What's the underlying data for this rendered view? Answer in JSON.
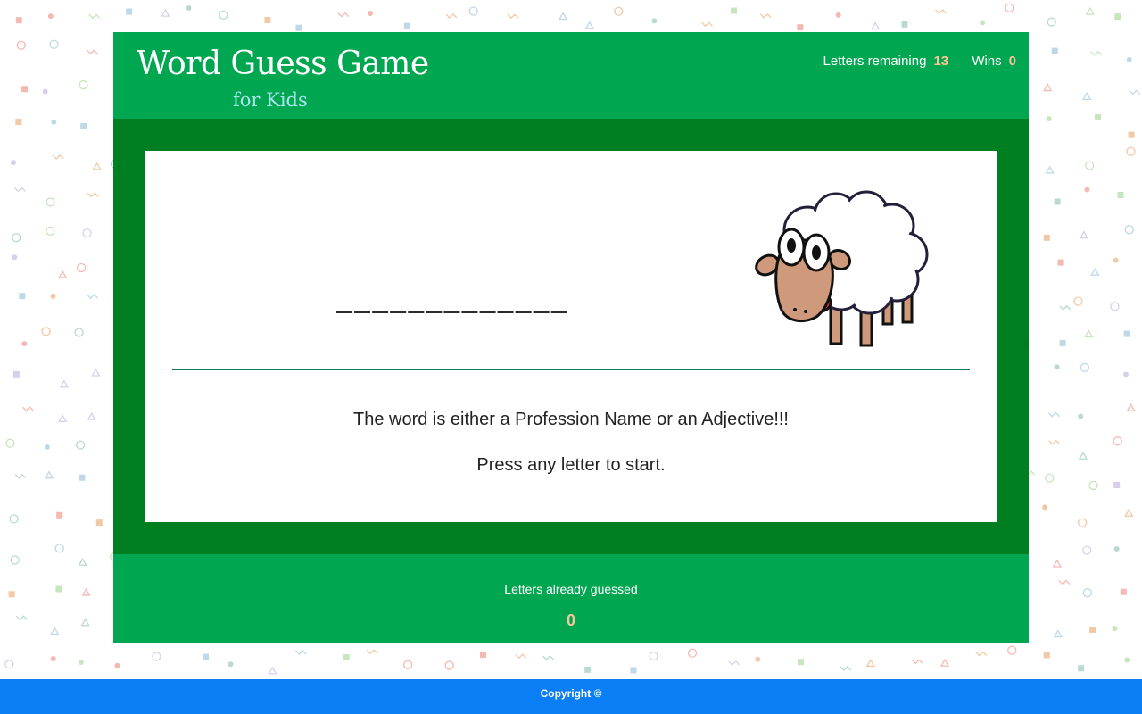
{
  "header": {
    "title": "Word Guess Game",
    "subtitle": "for Kids",
    "letters_remaining_label": "Letters remaining",
    "letters_remaining_value": "13",
    "wins_label": "Wins",
    "wins_value": "0"
  },
  "game": {
    "word_blanks": "_____________",
    "mascot_icon": "sheep-icon",
    "hint_line1": "The word is either a Profession Name or an Adjective!!!",
    "hint_line2": "Press any letter to start."
  },
  "guessed": {
    "label": "Letters already guessed",
    "value": "0"
  },
  "footer": {
    "copyright": "Copyright ©"
  },
  "colors": {
    "header_green": "#00a650",
    "panel_dark_green": "#007f22",
    "accent_peach": "#f8c69a",
    "subtitle_cyan": "#a8e4ea",
    "footer_blue": "#0a7ff5",
    "divider_teal": "#0f7768"
  }
}
